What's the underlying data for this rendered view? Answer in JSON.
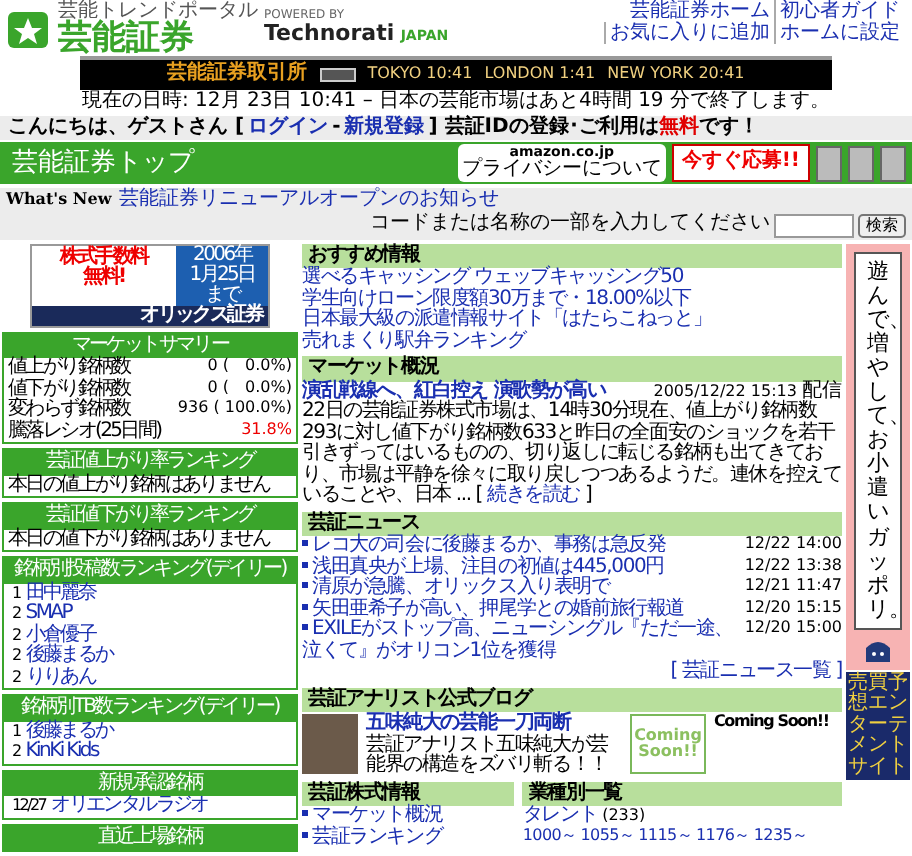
{
  "header": {
    "tagline": "芸能トレンドポータル",
    "logo": "芸能証券",
    "powered_by": "POWERED BY",
    "technorati": "Technorati",
    "japan": "JAPAN",
    "links": [
      "芸能証券ホーム",
      "初心者ガイド",
      "お気に入りに追加",
      "ホームに設定"
    ]
  },
  "ticker": {
    "title": "芸能証券取引所",
    "clocks": [
      "TOKYO 10:41",
      "LONDON 1:41",
      "NEW YORK 20:41"
    ]
  },
  "date_line": "現在の日時: 12月 23日 10:41 – 日本の芸能市場はあと4時間 19 分で終了します。",
  "greeting": [
    {
      "kind": "text",
      "text": "こんにちは、ゲストさん ["
    },
    {
      "kind": "link",
      "text": "ログイン"
    },
    {
      "kind": "text",
      "text": "-"
    },
    {
      "kind": "link",
      "text": "新規登録"
    },
    {
      "kind": "text",
      "text": "]"
    },
    {
      "kind": "notice",
      "text": "芸証IDの登録･ご利用は",
      "highlight": "無料",
      "after": "です！"
    }
  ],
  "title_bar": {
    "title": "芸能証券トップ",
    "amazon": "amazon.co.jp",
    "amazon_note": "プライバシーについて",
    "apply": "今すぐ応募!!"
  },
  "whats_new": {
    "label": "What's New",
    "link": "芸能証券リニューアルオープンのお知らせ",
    "search_hint": "コードまたは名称の一部を入力してください",
    "search_button": "検索"
  },
  "left": {
    "banner": {
      "line1": "株式手数料",
      "line2": "無料!",
      "year": "2006年",
      "date": "1月25日",
      "until": "まで",
      "broker": "オリックス証券"
    },
    "market_summary": {
      "title": "マーケットサマリー",
      "rows": [
        {
          "kind": "count",
          "label": "値上がり銘柄数",
          "value": "0 (　0.0%)"
        },
        {
          "kind": "count",
          "label": "値下がり銘柄数",
          "value": "0 (　0.0%)"
        },
        {
          "kind": "count",
          "label": "変わらず銘柄数",
          "value": "936 ( 100.0%)"
        },
        {
          "kind": "ratio",
          "label": "騰落レシオ(25日間)",
          "value": "31.8%"
        }
      ]
    },
    "panels": [
      {
        "kind": "message",
        "title": "芸証値上がり率ランキング",
        "message": "本日の値上がり銘柄はありません"
      },
      {
        "kind": "message",
        "title": "芸証値下がり率ランキング",
        "message": "本日の値下がり銘柄はありません"
      },
      {
        "kind": "ranked",
        "title": "銘柄別投稿数ランキング(デイリー)",
        "items": [
          {
            "rank": "1",
            "name": "田中麗奈"
          },
          {
            "rank": "2",
            "name": "SMAP"
          },
          {
            "rank": "2",
            "name": "小倉優子"
          },
          {
            "rank": "2",
            "name": "後藤まるか"
          },
          {
            "rank": "2",
            "name": "りりあん"
          }
        ]
      },
      {
        "kind": "ranked",
        "title": "銘柄別TB数ランキング(デイリー)",
        "items": [
          {
            "rank": "1",
            "name": "後藤まるか"
          },
          {
            "rank": "2",
            "name": "KinKi Kids"
          }
        ]
      },
      {
        "kind": "ranked",
        "title": "新規承認銘柄",
        "items": [
          {
            "rank": "12/27",
            "name": "オリエンタルラジオ"
          }
        ]
      },
      {
        "kind": "message",
        "title": "直近上場銘柄"
      }
    ]
  },
  "center": {
    "recommended": {
      "title": "おすすめ情報",
      "links": [
        "選べるキャッシング ウェッブキャッシング50",
        "学生向けローン限度額30万まで・18.00%以下",
        "日本最大級の派遣情報サイト「はたらこねっと」",
        "売れまくり駅弁ランキング"
      ]
    },
    "market": {
      "title": "マーケット概況",
      "headline": "演乱戦線へ、紅白控え 演歌勢が高い",
      "date": "2005/12/22 15:13",
      "suffix": "配信",
      "body": "22日の芸能証券株式市場は、14時30分現在、値上がり銘柄数293に対し値下がり銘柄数633と昨日の全面安のショックを若干引きずってはいるものの、切り返しに転じる銘柄も出てきており、市場は平静を徐々に取り戻しつつあるようだ。連休を控えていることや、日本 ... [",
      "more": "続きを読む",
      "close": "]"
    },
    "news": {
      "title": "芸証ニュース",
      "items": [
        {
          "text": "レコ大の司会に後藤まるか、事務は急反発",
          "date": "12/22 14:00"
        },
        {
          "text": "浅田真央が上場、注目の初値は445,000円",
          "date": "12/22 13:38"
        },
        {
          "text": "清原が急騰、オリックス入り表明で",
          "date": "12/21 11:47"
        },
        {
          "text": "矢田亜希子が高い、押尾学との婚前旅行報道",
          "date": "12/20 15:15"
        },
        {
          "text": "EXILEがストップ高、ニューシングル『ただ一途、泣くて』がオリコン1位を獲得",
          "date": "12/20 15:00"
        }
      ],
      "more": "[ 芸証ニュース一覧 ]"
    },
    "blog": {
      "title": "芸証アナリスト公式ブログ",
      "entry_title": "五味純大の芸能一刀両断",
      "entry_text": "芸証アナリスト五味純大が芸能界の構造をズバリ斬る！！",
      "badge": "Coming Soon!!",
      "coming": "Coming Soon!!"
    },
    "stock_info": {
      "title": "芸証株式情報",
      "links": [
        "マーケット概況",
        "芸証ランキング"
      ]
    },
    "industries": {
      "title": "業種別一覧",
      "category": "タレント",
      "count": "(233)",
      "ranges": [
        "1000～",
        "1055～",
        "1115～",
        "1176～",
        "1235～"
      ]
    }
  },
  "ad": {
    "text": "遊んで、増やして、お小遣いガッポリ。",
    "footer": "売買予想エンターテメントサイト"
  }
}
